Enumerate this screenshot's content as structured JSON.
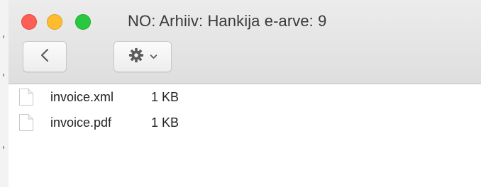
{
  "window": {
    "title": "NO: Arhiiv: Hankija e-arve: 9"
  },
  "toolbar": {
    "back_icon": "chevron-left-icon",
    "action_icon": "gear-icon",
    "action_dropdown_icon": "chevron-down-icon"
  },
  "colors": {
    "close": "#fd5f57",
    "minimize": "#febc2e",
    "zoom": "#28c840"
  },
  "files": [
    {
      "name": "invoice.xml",
      "size": "1 KB",
      "icon": "document-icon"
    },
    {
      "name": "invoice.pdf",
      "size": "1 KB",
      "icon": "document-icon"
    }
  ]
}
